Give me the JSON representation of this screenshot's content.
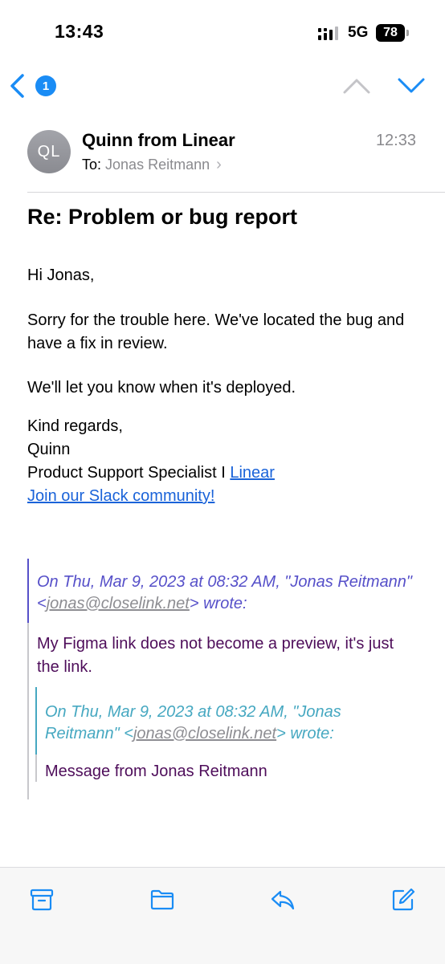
{
  "status_bar": {
    "time": "13:43",
    "network": "5G",
    "battery": "78"
  },
  "nav": {
    "badge_count": "1",
    "accent": "#1a8cf5"
  },
  "header": {
    "avatar_initials": "QL",
    "sender": "Quinn from Linear",
    "to_label": "To:",
    "to_name": "Jonas Reitmann",
    "time": "12:33"
  },
  "subject": "Re: Problem or bug report",
  "body": {
    "greeting": "Hi Jonas,",
    "paragraph1": "Sorry for the trouble here. We've located the bug and have a fix in review.",
    "paragraph2": "We'll let you know when it's deployed.",
    "signoff": "Kind regards,",
    "name": "Quinn",
    "title": "Product Support Specialist I",
    "title_link": "Linear",
    "slack_link": "Join our Slack community!"
  },
  "quote1": {
    "attr_prefix": "On Thu, Mar 9, 2023 at 08:32 AM, \"Jonas Reitmann\" <",
    "email": "jonas@closelink.net",
    "attr_suffix": "> wrote:",
    "text": "My Figma link does not become a preview, it's just the link."
  },
  "quote2": {
    "attr_prefix": "On Thu, Mar 9, 2023 at 08:32 AM, \"Jonas Reitmann\" <",
    "email": "jonas@closelink.net",
    "attr_suffix": "> wrote:",
    "text": "Message from Jonas Reitmann"
  },
  "toolbar": {
    "icons": [
      "archive-icon",
      "folder-icon",
      "reply-icon",
      "compose-icon"
    ]
  }
}
